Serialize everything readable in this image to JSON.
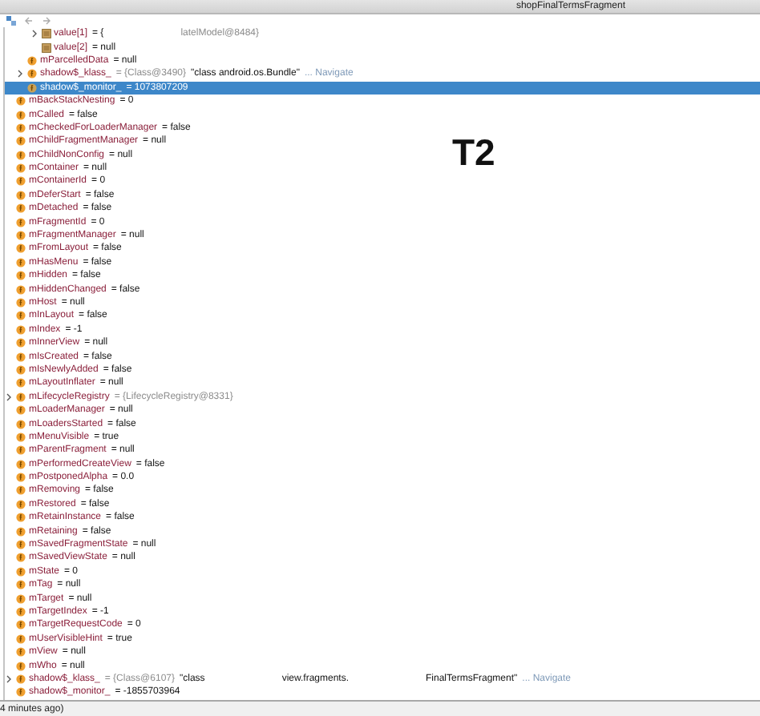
{
  "title": "shopFinalTermsFragment",
  "variables": [
    {
      "children": [
        {
          "children": [
            {
              "kind": "element",
              "name": "value[1]",
              "expandable": true,
              "selected": false,
              "parts": [
                {
                  "text": "= {",
                  "kind": "value"
                },
                {
                  "text": "latelModel@8484}",
                  "kind": "ref",
                  "far": true
                }
              ]
            },
            {
              "kind": "element",
              "name": "value[2]",
              "expandable": false,
              "selected": false,
              "parts": [
                {
                  "text": "= null",
                  "kind": "value"
                }
              ]
            }
          ]
        },
        {
          "kind": "field",
          "name": "mParcelledData",
          "expandable": false,
          "selected": false,
          "parts": [
            {
              "text": "= null",
              "kind": "value"
            }
          ]
        },
        {
          "kind": "field",
          "name": "shadow$_klass_",
          "expandable": true,
          "selected": false,
          "parts": [
            {
              "text": "= {Class@3490}",
              "kind": "ref"
            },
            {
              "text": "\"class android.os.Bundle\"",
              "kind": "value"
            },
            {
              "text": "... Navigate",
              "kind": "link"
            }
          ]
        },
        {
          "kind": "field",
          "name": "shadow$_monitor_",
          "expandable": false,
          "selected": true,
          "parts": [
            {
              "text": "= 1073807209",
              "kind": "value"
            }
          ]
        }
      ]
    },
    {
      "kind": "field",
      "name": "mBackStackNesting",
      "expandable": false,
      "selected": false,
      "parts": [
        {
          "text": "= 0",
          "kind": "value"
        }
      ]
    },
    {
      "kind": "field",
      "name": "mCalled",
      "expandable": false,
      "selected": false,
      "parts": [
        {
          "text": "= false",
          "kind": "value"
        }
      ]
    },
    {
      "kind": "field",
      "name": "mCheckedForLoaderManager",
      "expandable": false,
      "selected": false,
      "parts": [
        {
          "text": "= false",
          "kind": "value"
        }
      ]
    },
    {
      "kind": "field",
      "name": "mChildFragmentManager",
      "expandable": false,
      "selected": false,
      "parts": [
        {
          "text": "= null",
          "kind": "value"
        }
      ]
    },
    {
      "kind": "field",
      "name": "mChildNonConfig",
      "expandable": false,
      "selected": false,
      "parts": [
        {
          "text": "= null",
          "kind": "value"
        }
      ]
    },
    {
      "kind": "field",
      "name": "mContainer",
      "expandable": false,
      "selected": false,
      "parts": [
        {
          "text": "= null",
          "kind": "value"
        }
      ]
    },
    {
      "kind": "field",
      "name": "mContainerId",
      "expandable": false,
      "selected": false,
      "parts": [
        {
          "text": "= 0",
          "kind": "value"
        }
      ]
    },
    {
      "kind": "field",
      "name": "mDeferStart",
      "expandable": false,
      "selected": false,
      "parts": [
        {
          "text": "= false",
          "kind": "value"
        }
      ]
    },
    {
      "kind": "field",
      "name": "mDetached",
      "expandable": false,
      "selected": false,
      "parts": [
        {
          "text": "= false",
          "kind": "value"
        }
      ]
    },
    {
      "kind": "field",
      "name": "mFragmentId",
      "expandable": false,
      "selected": false,
      "parts": [
        {
          "text": "= 0",
          "kind": "value"
        }
      ]
    },
    {
      "kind": "field",
      "name": "mFragmentManager",
      "expandable": false,
      "selected": false,
      "parts": [
        {
          "text": "= null",
          "kind": "value"
        }
      ]
    },
    {
      "kind": "field",
      "name": "mFromLayout",
      "expandable": false,
      "selected": false,
      "parts": [
        {
          "text": "= false",
          "kind": "value"
        }
      ]
    },
    {
      "kind": "field",
      "name": "mHasMenu",
      "expandable": false,
      "selected": false,
      "parts": [
        {
          "text": "= false",
          "kind": "value"
        }
      ]
    },
    {
      "kind": "field",
      "name": "mHidden",
      "expandable": false,
      "selected": false,
      "parts": [
        {
          "text": "= false",
          "kind": "value"
        }
      ]
    },
    {
      "kind": "field",
      "name": "mHiddenChanged",
      "expandable": false,
      "selected": false,
      "parts": [
        {
          "text": "= false",
          "kind": "value"
        }
      ]
    },
    {
      "kind": "field",
      "name": "mHost",
      "expandable": false,
      "selected": false,
      "parts": [
        {
          "text": "= null",
          "kind": "value"
        }
      ]
    },
    {
      "kind": "field",
      "name": "mInLayout",
      "expandable": false,
      "selected": false,
      "parts": [
        {
          "text": "= false",
          "kind": "value"
        }
      ]
    },
    {
      "kind": "field",
      "name": "mIndex",
      "expandable": false,
      "selected": false,
      "parts": [
        {
          "text": "= -1",
          "kind": "value"
        }
      ]
    },
    {
      "kind": "field",
      "name": "mInnerView",
      "expandable": false,
      "selected": false,
      "parts": [
        {
          "text": "= null",
          "kind": "value"
        }
      ]
    },
    {
      "kind": "field",
      "name": "mIsCreated",
      "expandable": false,
      "selected": false,
      "parts": [
        {
          "text": "= false",
          "kind": "value"
        }
      ]
    },
    {
      "kind": "field",
      "name": "mIsNewlyAdded",
      "expandable": false,
      "selected": false,
      "parts": [
        {
          "text": "= false",
          "kind": "value"
        }
      ]
    },
    {
      "kind": "field",
      "name": "mLayoutInflater",
      "expandable": false,
      "selected": false,
      "parts": [
        {
          "text": "= null",
          "kind": "value"
        }
      ]
    },
    {
      "kind": "field",
      "name": "mLifecycleRegistry",
      "expandable": true,
      "selected": false,
      "parts": [
        {
          "text": "= {LifecycleRegistry@8331}",
          "kind": "ref"
        }
      ]
    },
    {
      "kind": "field",
      "name": "mLoaderManager",
      "expandable": false,
      "selected": false,
      "parts": [
        {
          "text": "= null",
          "kind": "value"
        }
      ]
    },
    {
      "kind": "field",
      "name": "mLoadersStarted",
      "expandable": false,
      "selected": false,
      "parts": [
        {
          "text": "= false",
          "kind": "value"
        }
      ]
    },
    {
      "kind": "field",
      "name": "mMenuVisible",
      "expandable": false,
      "selected": false,
      "parts": [
        {
          "text": "= true",
          "kind": "value"
        }
      ]
    },
    {
      "kind": "field",
      "name": "mParentFragment",
      "expandable": false,
      "selected": false,
      "parts": [
        {
          "text": "= null",
          "kind": "value"
        }
      ]
    },
    {
      "kind": "field",
      "name": "mPerformedCreateView",
      "expandable": false,
      "selected": false,
      "parts": [
        {
          "text": "= false",
          "kind": "value"
        }
      ]
    },
    {
      "kind": "field",
      "name": "mPostponedAlpha",
      "expandable": false,
      "selected": false,
      "parts": [
        {
          "text": "= 0.0",
          "kind": "value"
        }
      ]
    },
    {
      "kind": "field",
      "name": "mRemoving",
      "expandable": false,
      "selected": false,
      "parts": [
        {
          "text": "= false",
          "kind": "value"
        }
      ]
    },
    {
      "kind": "field",
      "name": "mRestored",
      "expandable": false,
      "selected": false,
      "parts": [
        {
          "text": "= false",
          "kind": "value"
        }
      ]
    },
    {
      "kind": "field",
      "name": "mRetainInstance",
      "expandable": false,
      "selected": false,
      "parts": [
        {
          "text": "= false",
          "kind": "value"
        }
      ]
    },
    {
      "kind": "field",
      "name": "mRetaining",
      "expandable": false,
      "selected": false,
      "parts": [
        {
          "text": "= false",
          "kind": "value"
        }
      ]
    },
    {
      "kind": "field",
      "name": "mSavedFragmentState",
      "expandable": false,
      "selected": false,
      "parts": [
        {
          "text": "= null",
          "kind": "value"
        }
      ]
    },
    {
      "kind": "field",
      "name": "mSavedViewState",
      "expandable": false,
      "selected": false,
      "parts": [
        {
          "text": "= null",
          "kind": "value"
        }
      ]
    },
    {
      "kind": "field",
      "name": "mState",
      "expandable": false,
      "selected": false,
      "parts": [
        {
          "text": "= 0",
          "kind": "value"
        }
      ]
    },
    {
      "kind": "field",
      "name": "mTag",
      "expandable": false,
      "selected": false,
      "parts": [
        {
          "text": "= null",
          "kind": "value"
        }
      ]
    },
    {
      "kind": "field",
      "name": "mTarget",
      "expandable": false,
      "selected": false,
      "parts": [
        {
          "text": "= null",
          "kind": "value"
        }
      ]
    },
    {
      "kind": "field",
      "name": "mTargetIndex",
      "expandable": false,
      "selected": false,
      "parts": [
        {
          "text": "= -1",
          "kind": "value"
        }
      ]
    },
    {
      "kind": "field",
      "name": "mTargetRequestCode",
      "expandable": false,
      "selected": false,
      "parts": [
        {
          "text": "= 0",
          "kind": "value"
        }
      ]
    },
    {
      "kind": "field",
      "name": "mUserVisibleHint",
      "expandable": false,
      "selected": false,
      "parts": [
        {
          "text": "= true",
          "kind": "value"
        }
      ]
    },
    {
      "kind": "field",
      "name": "mView",
      "expandable": false,
      "selected": false,
      "parts": [
        {
          "text": "= null",
          "kind": "value"
        }
      ]
    },
    {
      "kind": "field",
      "name": "mWho",
      "expandable": false,
      "selected": false,
      "parts": [
        {
          "text": "= null",
          "kind": "value"
        }
      ]
    },
    {
      "kind": "field",
      "name": "shadow$_klass_",
      "expandable": true,
      "selected": false,
      "parts": [
        {
          "text": "= {Class@6107}",
          "kind": "ref"
        },
        {
          "text": "\"class",
          "kind": "value"
        },
        {
          "text": "view.fragments.",
          "kind": "value",
          "far": true
        },
        {
          "text": "FinalTermsFragment\"",
          "kind": "value",
          "far": true
        },
        {
          "text": "... Navigate",
          "kind": "link"
        }
      ]
    },
    {
      "kind": "field",
      "name": "shadow$_monitor_",
      "expandable": false,
      "selected": false,
      "parts": [
        {
          "text": "= -1855703964",
          "kind": "value"
        }
      ]
    }
  ],
  "annotation": "T2",
  "status": "4 minutes ago)"
}
